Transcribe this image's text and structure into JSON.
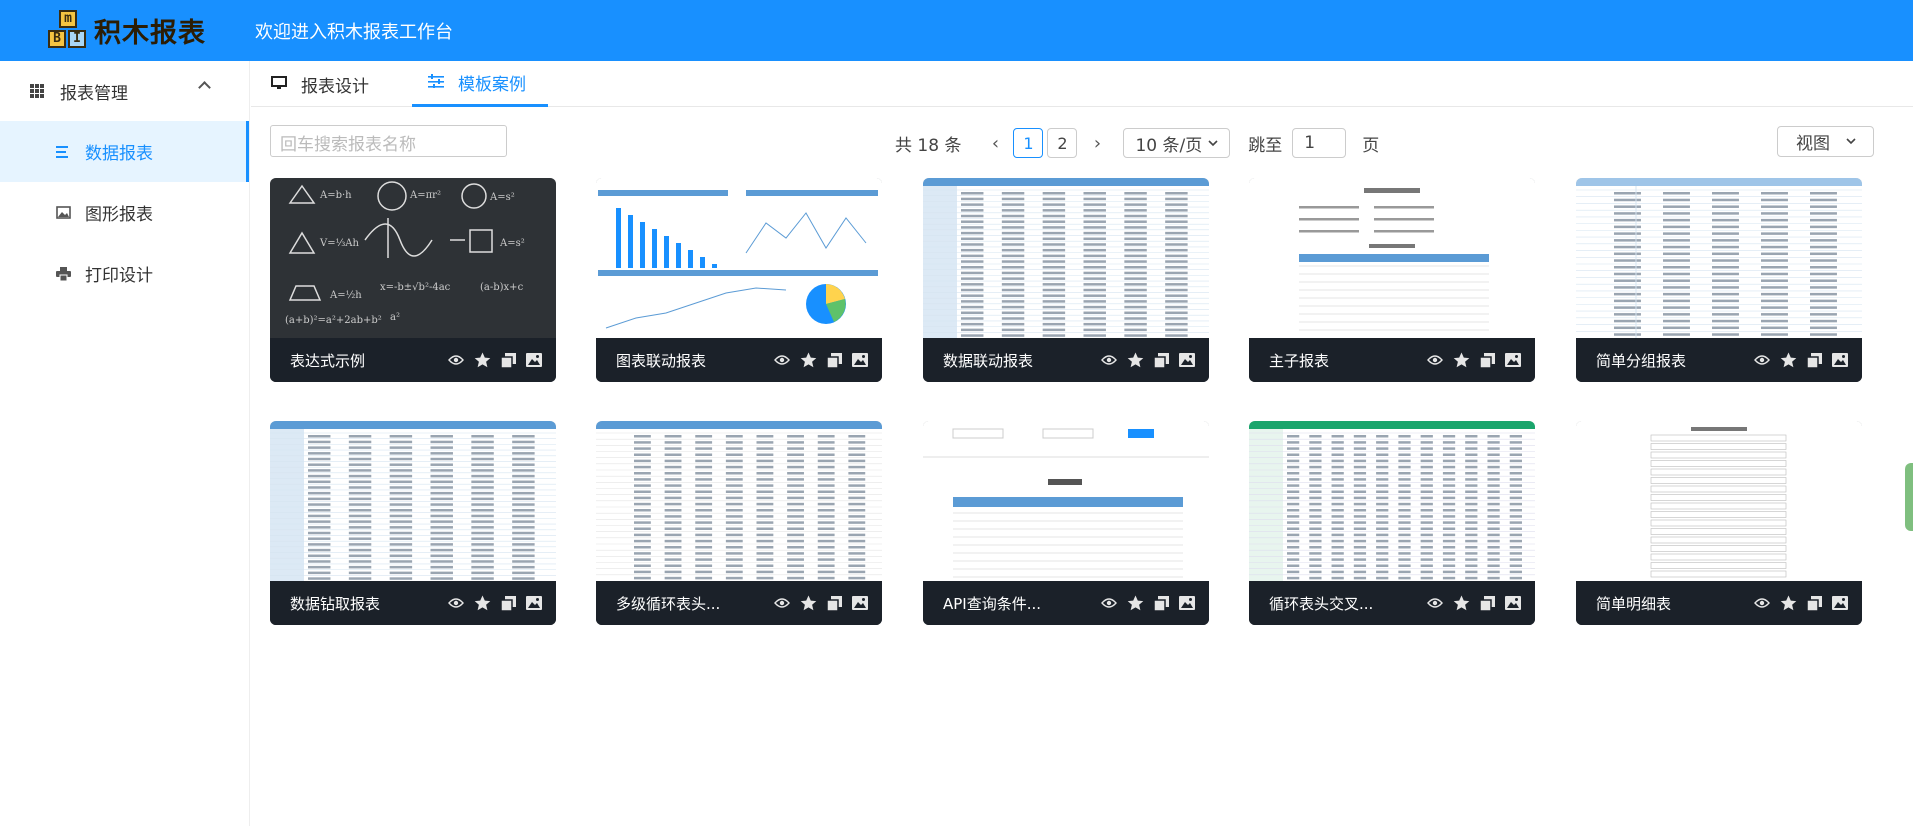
{
  "header": {
    "logo_text": "积木报表",
    "logo_letters": [
      "m",
      "B",
      "I"
    ],
    "welcome": "欢迎进入积木报表工作台"
  },
  "sidebar": {
    "group": {
      "label": "报表管理",
      "icon": "grid-icon"
    },
    "items": [
      {
        "label": "数据报表",
        "icon": "list-icon",
        "active": true
      },
      {
        "label": "图形报表",
        "icon": "picture-icon",
        "active": false
      },
      {
        "label": "打印设计",
        "icon": "printer-icon",
        "active": false
      }
    ]
  },
  "tabs": [
    {
      "label": "报表设计",
      "icon": "monitor-icon",
      "active": false
    },
    {
      "label": "模板案例",
      "icon": "sliders-icon",
      "active": true
    }
  ],
  "search": {
    "placeholder": "回车搜索报表名称"
  },
  "pagination": {
    "total": "共 18 条",
    "pages": [
      "1",
      "2"
    ],
    "current": "1",
    "page_size": "10 条/页",
    "jump_label": "跳至",
    "jump_value": "1",
    "page_unit": "页"
  },
  "view_button": "视图",
  "cards": [
    {
      "title": "表达式示例",
      "thumb": "chalkboard"
    },
    {
      "title": "图表联动报表",
      "thumb": "charts"
    },
    {
      "title": "数据联动报表",
      "thumb": "table-blue"
    },
    {
      "title": "主子报表",
      "thumb": "master-detail"
    },
    {
      "title": "简单分组报表",
      "thumb": "grouped"
    },
    {
      "title": "数据钻取报表",
      "thumb": "table-blue"
    },
    {
      "title": "多级循环表头...",
      "thumb": "multi-header"
    },
    {
      "title": "API查询条件...",
      "thumb": "sales"
    },
    {
      "title": "循环表头交叉...",
      "thumb": "green-table"
    },
    {
      "title": "简单明细表",
      "thumb": "detail"
    }
  ],
  "card_actions": [
    "eye-icon",
    "star-icon",
    "copy-icon",
    "image-icon"
  ],
  "colors": {
    "primary": "#1890ff",
    "card_caption": "#1b2129",
    "active_bg": "#e6f4ff"
  }
}
